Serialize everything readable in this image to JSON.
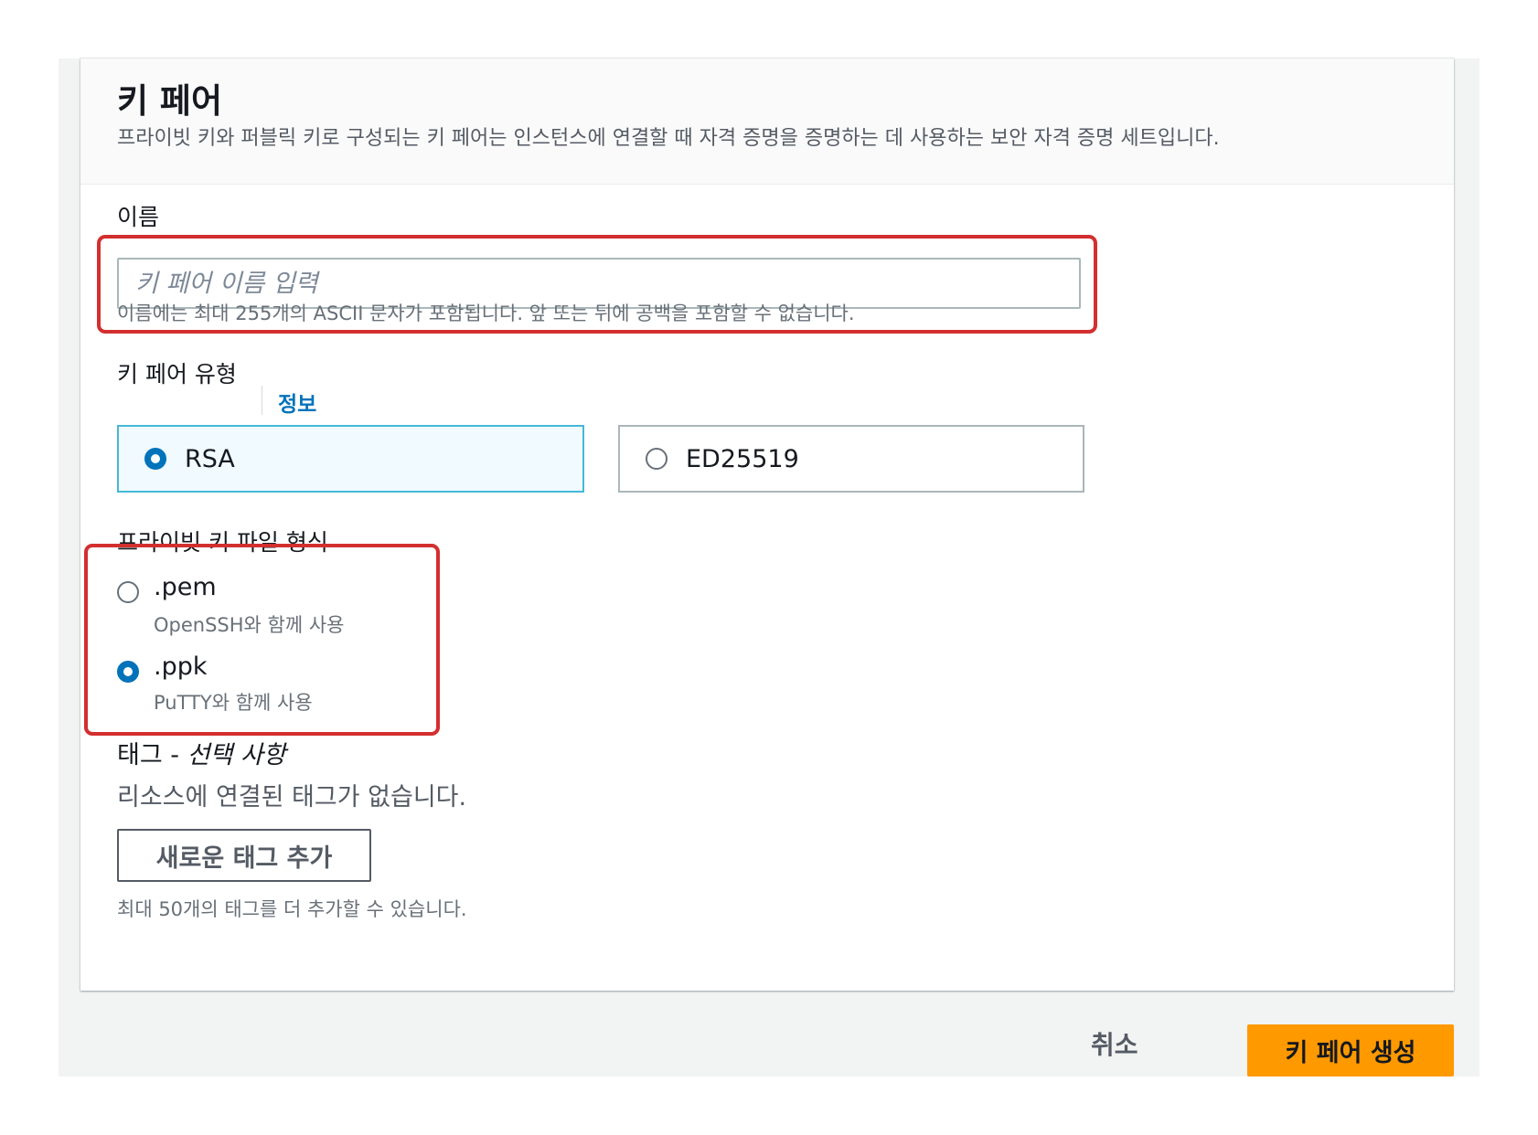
{
  "header": {
    "title": "키 페어",
    "description": "프라이빗 키와 퍼블릭 키로 구성되는 키 페어는 인스턴스에 연결할 때 자격 증명을 증명하는 데 사용하는 보안 자격 증명 세트입니다."
  },
  "name_field": {
    "label": "이름",
    "placeholder": "키 페어 이름 입력",
    "value": "",
    "hint": "이름에는 최대 255개의 ASCII 문자가 포함됩니다. 앞 또는 뒤에 공백을 포함할 수 없습니다."
  },
  "key_type": {
    "label": "키 페어 유형",
    "info_link": "정보",
    "selected": "RSA",
    "options": [
      {
        "label": "RSA",
        "checked": true
      },
      {
        "label": "ED25519",
        "checked": false
      }
    ]
  },
  "file_format": {
    "label": "프라이빗 키 파일 형식",
    "selected": ".ppk",
    "options": [
      {
        "label": ".pem",
        "description": "OpenSSH와 함께 사용",
        "checked": false
      },
      {
        "label": ".ppk",
        "description": "PuTTY와 함께 사용",
        "checked": true
      }
    ]
  },
  "tags": {
    "title": "태그 -",
    "optional": "선택 사항",
    "empty_text": "리소스에 연결된 태그가 없습니다.",
    "add_button": "새로운 태그 추가",
    "limit_text": "최대 50개의 태그를 더 추가할 수 있습니다."
  },
  "footer": {
    "cancel_label": "취소",
    "create_label": "키 페어 생성"
  },
  "colors": {
    "primary_button": "#ff9900",
    "radio_selected": "#0073bb",
    "highlight": "#d32f2f",
    "selected_tile_border": "#44b9d6"
  }
}
